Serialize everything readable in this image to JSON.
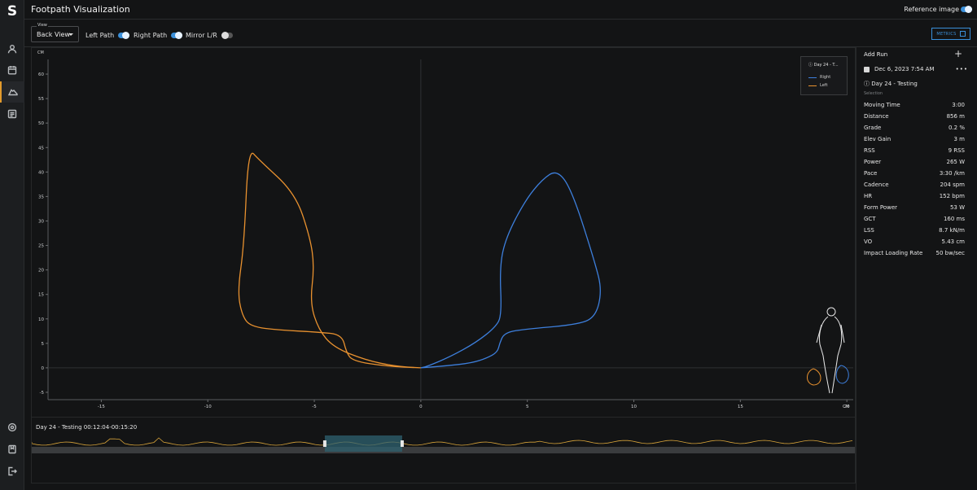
{
  "app": {
    "logo": "S",
    "title": "Footpath Visualization"
  },
  "header": {
    "reference_label": "Reference image",
    "reference_on": true
  },
  "nav": [
    {
      "icon": "user-icon"
    },
    {
      "icon": "calendar-icon"
    },
    {
      "icon": "shoe-icon",
      "active": true
    },
    {
      "icon": "report-icon"
    }
  ],
  "nav_bottom": [
    {
      "icon": "settings-icon"
    },
    {
      "icon": "bookmark-icon"
    },
    {
      "icon": "logout-icon"
    }
  ],
  "toolbar": {
    "view_caption": "View",
    "view_value": "Back View",
    "left_path_label": "Left Path",
    "left_path_on": true,
    "right_path_label": "Right Path",
    "right_path_on": true,
    "mirror_label": "Mirror L/R",
    "mirror_on": false,
    "metrics_label": "METRICS"
  },
  "chart_data": {
    "type": "line",
    "x_unit": "CM",
    "y_unit": "CM",
    "xlim": [
      -17.5,
      20.3
    ],
    "ylim": [
      -6.5,
      63
    ],
    "x_ticks": [
      -15,
      -10,
      -5,
      0,
      5,
      10,
      15,
      20
    ],
    "y_ticks": [
      -5,
      0,
      5,
      10,
      15,
      20,
      25,
      30,
      35,
      40,
      45,
      50,
      55,
      60
    ],
    "legend_title": "Day 24 - T...",
    "series": [
      {
        "name": "Right",
        "color": "#3d7fdc",
        "points": [
          [
            0,
            0
          ],
          [
            1.2,
            0.4
          ],
          [
            2.4,
            1.0
          ],
          [
            3.1,
            2.0
          ],
          [
            3.6,
            3.2
          ],
          [
            3.7,
            5.0
          ],
          [
            3.9,
            7.0
          ],
          [
            4.6,
            7.8
          ],
          [
            7.3,
            8.8
          ],
          [
            8.2,
            10.3
          ],
          [
            8.5,
            15.7
          ],
          [
            8.2,
            21.2
          ],
          [
            7.1,
            36.2
          ],
          [
            6.4,
            40.5
          ],
          [
            5.7,
            38.5
          ],
          [
            4.9,
            34.2
          ],
          [
            4.0,
            26.7
          ],
          [
            3.7,
            20.7
          ],
          [
            3.8,
            10.7
          ],
          [
            3.5,
            8.3
          ],
          [
            2.6,
            5.2
          ],
          [
            1.4,
            2.3
          ],
          [
            0.3,
            0.3
          ],
          [
            0,
            0
          ]
        ]
      },
      {
        "name": "Left",
        "color": "#e8912f",
        "points": [
          [
            0,
            0
          ],
          [
            -1.6,
            0.3
          ],
          [
            -3.2,
            1.4
          ],
          [
            -3.5,
            3.2
          ],
          [
            -3.7,
            6.8
          ],
          [
            -4.8,
            7.3
          ],
          [
            -6.6,
            7.7
          ],
          [
            -8.0,
            8.4
          ],
          [
            -8.4,
            10.8
          ],
          [
            -8.6,
            15.7
          ],
          [
            -8.3,
            25.0
          ],
          [
            -8.1,
            44.9
          ],
          [
            -7.6,
            42.5
          ],
          [
            -5.9,
            35.7
          ],
          [
            -5.2,
            26.7
          ],
          [
            -5.0,
            20.7
          ],
          [
            -5.2,
            13.3
          ],
          [
            -4.8,
            7.8
          ],
          [
            -4.1,
            4.2
          ],
          [
            -2.6,
            1.6
          ],
          [
            -1.2,
            0.3
          ],
          [
            0,
            0
          ]
        ]
      }
    ]
  },
  "panel": {
    "add_run": "Add Run",
    "run_date": "Dec 6, 2023 7:54 AM",
    "run_name": "Day 24 - Testing",
    "selection_label": "Selection",
    "metrics": [
      {
        "label": "Moving Time",
        "value": "3:00"
      },
      {
        "label": "Distance",
        "value": "856 m"
      },
      {
        "label": "Grade",
        "value": "0.2 %"
      },
      {
        "label": "Elev Gain",
        "value": "3 m"
      },
      {
        "label": "RSS",
        "value": "9 RSS"
      },
      {
        "label": "Power",
        "value": "265 W"
      },
      {
        "label": "Pace",
        "value": "3:30 /km"
      },
      {
        "label": "Cadence",
        "value": "204 spm"
      },
      {
        "label": "HR",
        "value": "152 bpm"
      },
      {
        "label": "Form Power",
        "value": "53 W"
      },
      {
        "label": "GCT",
        "value": "160 ms"
      },
      {
        "label": "LSS",
        "value": "8.7 kN/m"
      },
      {
        "label": "VO",
        "value": "5.43 cm"
      },
      {
        "label": "Impact Loading Rate",
        "value": "50 bw/sec"
      }
    ]
  },
  "timeline": {
    "title": "Day 24 - Testing  00:12:04-00:15:20",
    "selection": [
      0.356,
      0.45
    ]
  }
}
